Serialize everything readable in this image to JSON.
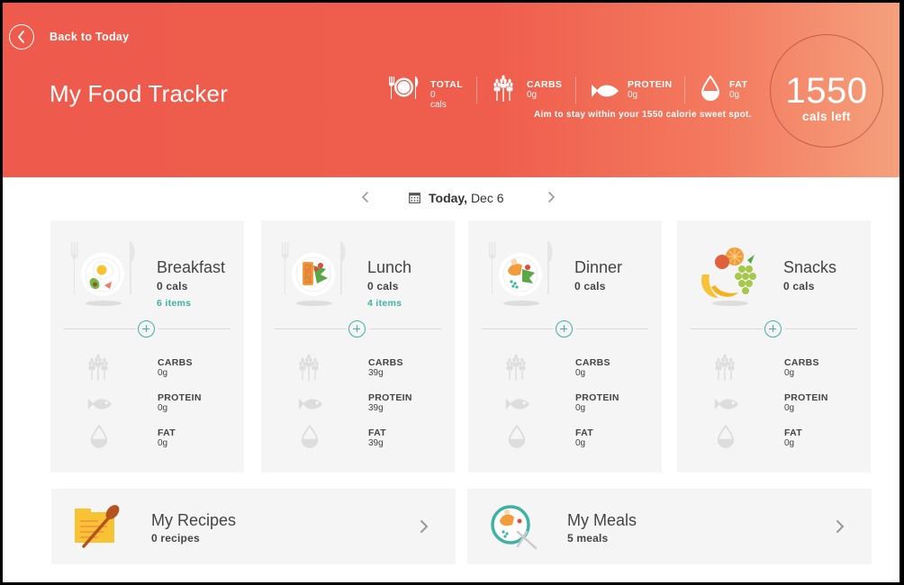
{
  "header": {
    "back_label": "Back to Today",
    "title": "My Food Tracker",
    "stats": [
      {
        "label": "TOTAL",
        "value": "0 cals",
        "icon": "plate-cutlery-icon"
      },
      {
        "label": "CARBS",
        "value": "0g",
        "icon": "wheat-icon"
      },
      {
        "label": "PROTEIN",
        "value": "0g",
        "icon": "fish-icon"
      },
      {
        "label": "FAT",
        "value": "0g",
        "icon": "drop-icon"
      }
    ],
    "aim_text": "Aim to stay within your 1550 calorie sweet spot.",
    "cals_left_value": "1550",
    "cals_left_label": "cals left"
  },
  "date_nav": {
    "day": "Today,",
    "date": "Dec 6"
  },
  "meals": [
    {
      "name": "Breakfast",
      "cals": "0 cals",
      "items": "6 items",
      "nutrients": [
        {
          "label": "CARBS",
          "value": "0g"
        },
        {
          "label": "PROTEIN",
          "value": "0g"
        },
        {
          "label": "FAT",
          "value": "0g"
        }
      ]
    },
    {
      "name": "Lunch",
      "cals": "0 cals",
      "items": "4 items",
      "nutrients": [
        {
          "label": "CARBS",
          "value": "39g"
        },
        {
          "label": "PROTEIN",
          "value": "39g"
        },
        {
          "label": "FAT",
          "value": "39g"
        }
      ]
    },
    {
      "name": "Dinner",
      "cals": "0 cals",
      "items": "",
      "nutrients": [
        {
          "label": "CARBS",
          "value": "0g"
        },
        {
          "label": "PROTEIN",
          "value": "0g"
        },
        {
          "label": "FAT",
          "value": "0g"
        }
      ]
    },
    {
      "name": "Snacks",
      "cals": "0 cals",
      "items": "",
      "nutrients": [
        {
          "label": "CARBS",
          "value": "0g"
        },
        {
          "label": "PROTEIN",
          "value": "0g"
        },
        {
          "label": "FAT",
          "value": "0g"
        }
      ]
    }
  ],
  "bottom": {
    "recipes": {
      "title": "My Recipes",
      "sub": "0 recipes"
    },
    "meals": {
      "title": "My Meals",
      "sub": "5 meals"
    }
  },
  "colors": {
    "header_start": "#ee5a4c",
    "header_end": "#f5a07c",
    "accent_teal": "#3fb2a3",
    "card_bg": "#f5f5f5",
    "text_dark": "#444444"
  }
}
